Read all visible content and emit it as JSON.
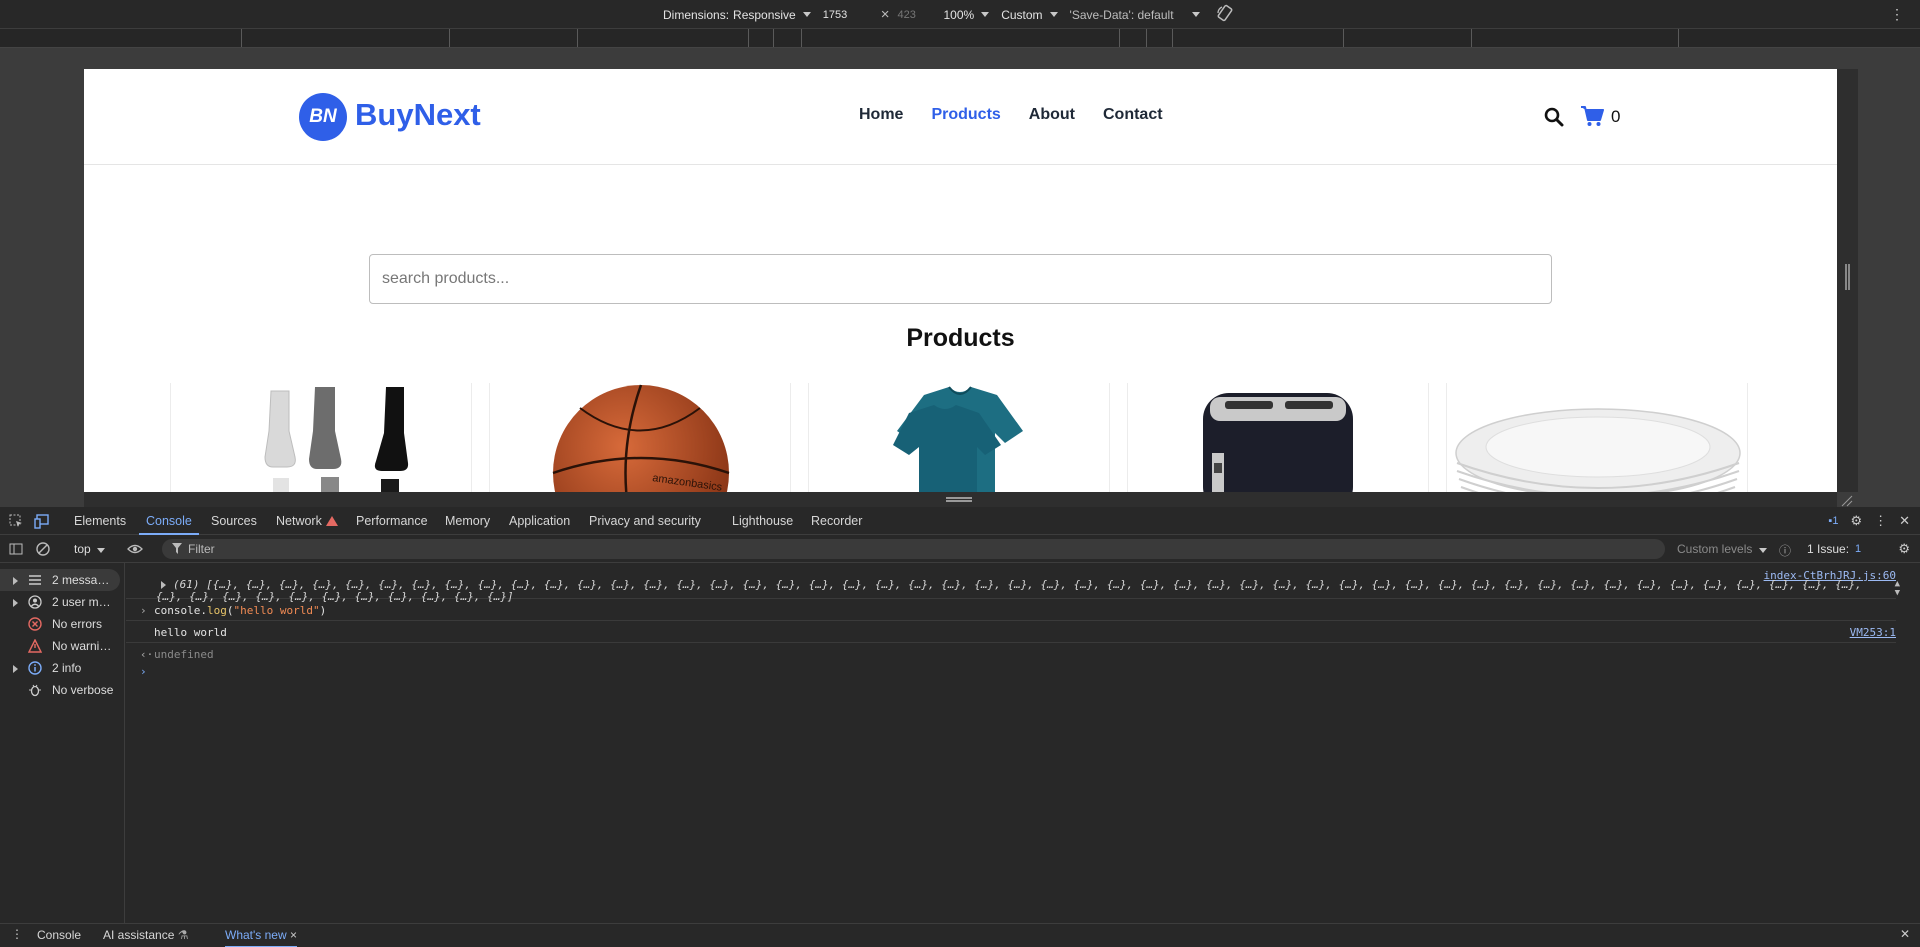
{
  "device_toolbar": {
    "dimensions_label": "Dimensions:",
    "dimensions_value": "Responsive",
    "width": "1753",
    "height": "423",
    "zoom": "100%",
    "throttle": "Custom",
    "save_data": "'Save-Data': default"
  },
  "site": {
    "logo_initials": "BN",
    "logo_text": "BuyNext",
    "nav": [
      "Home",
      "Products",
      "About",
      "Contact"
    ],
    "active_nav": "Products",
    "cart_count": "0",
    "search_placeholder": "search products...",
    "products_title": "Products",
    "products": [
      {
        "name": "socks-image"
      },
      {
        "name": "basketball-image",
        "brand_mark": "amazonbasics"
      },
      {
        "name": "tshirt-image"
      },
      {
        "name": "toaster-image"
      },
      {
        "name": "plates-image"
      }
    ]
  },
  "devtools": {
    "tabs": [
      "Elements",
      "Console",
      "Sources",
      "Network",
      "Performance",
      "Memory",
      "Application",
      "Privacy and security",
      "Lighthouse",
      "Recorder"
    ],
    "active_tab": "Console",
    "issues_badge": "1",
    "context": "top",
    "filter_placeholder": "Filter",
    "levels": "Custom levels",
    "issues_label": "1 Issue:",
    "issues_count": "1",
    "sidebar": [
      {
        "label": "2 messa…",
        "expandable": true,
        "icon": "list-icon"
      },
      {
        "label": "2 user m…",
        "expandable": true,
        "icon": "user-icon"
      },
      {
        "label": "No errors",
        "expandable": false,
        "icon": "error-icon"
      },
      {
        "label": "No warni…",
        "expandable": false,
        "icon": "warning-icon"
      },
      {
        "label": "2 info",
        "expandable": true,
        "icon": "info-icon"
      },
      {
        "label": "No verbose",
        "expandable": false,
        "icon": "bug-icon"
      }
    ],
    "console": {
      "array_line1": "(61) [{…}, {…}, {…}, {…}, {…}, {…}, {…}, {…}, {…}, {…}, {…}, {…}, {…}, {…}, {…}, {…}, {…}, {…}, {…}, {…}, {…}, {…}, {…}, {…}, {…}, {…}, {…}, {…}, {…}, {…}, {…}, {…}, {…}, {…}, {…}, {…}, {…}, {…}, {…}, {…}, {…}, {…}, {…}, {…}, {…}, {…}, {…}, {…}, {…}, {…},",
      "array_line2": "{…}, {…}, {…}, {…}, {…}, {…}, {…}, {…}, {…}, {…}, {…}]",
      "array_source": "index-CtBrhJRJ.js:60",
      "cmd_prefix": "console.",
      "cmd_fn": "log",
      "cmd_open": "(",
      "cmd_arg": "\"hello world\"",
      "cmd_close": ")",
      "output": "hello world",
      "output_source": "VM253:1",
      "result": "undefined"
    },
    "drawer_tabs": [
      "Console",
      "AI assistance",
      "What's new"
    ],
    "active_drawer_tab": "What's new"
  },
  "colors": {
    "brand": "#2f5fe8",
    "devtools_accent": "#7cacf8",
    "devtools_bg": "#282828"
  }
}
